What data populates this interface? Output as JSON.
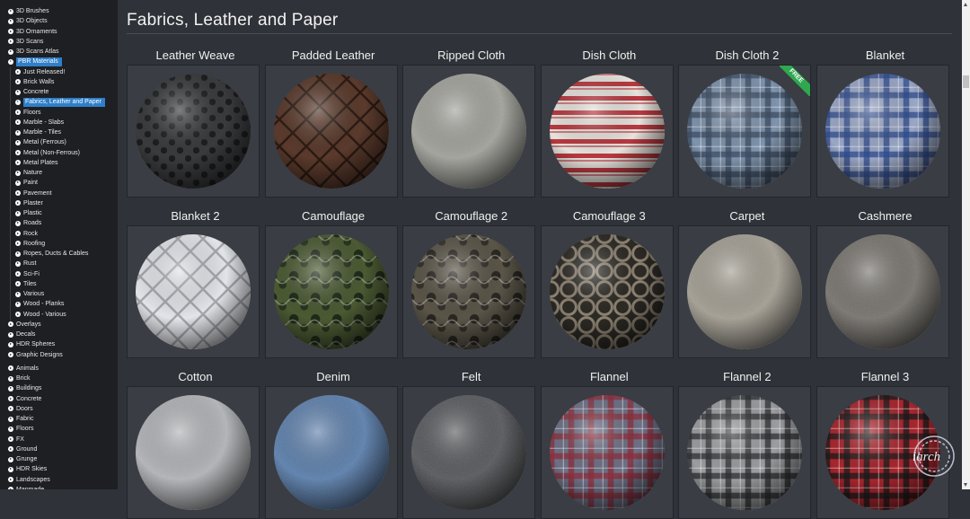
{
  "sidebar": {
    "items": [
      {
        "label": "3D Brushes",
        "level": 0
      },
      {
        "label": "3D Objects",
        "level": 0
      },
      {
        "label": "3D Ornaments",
        "level": 0
      },
      {
        "label": "3D Scans",
        "level": 0
      },
      {
        "label": "3D Scans Atlas",
        "level": 0
      },
      {
        "label": "PBR Materials",
        "level": 0,
        "active": true
      },
      {
        "label": "Just Released!",
        "level": 1
      },
      {
        "label": "Brick Walls",
        "level": 1
      },
      {
        "label": "Concrete",
        "level": 1
      },
      {
        "label": "Fabrics, Leather and Paper",
        "level": 1,
        "active": true
      },
      {
        "label": "Floors",
        "level": 1
      },
      {
        "label": "Marble - Slabs",
        "level": 1
      },
      {
        "label": "Marble - Tiles",
        "level": 1
      },
      {
        "label": "Metal (Ferrous)",
        "level": 1
      },
      {
        "label": "Metal (Non-Ferrous)",
        "level": 1
      },
      {
        "label": "Metal Plates",
        "level": 1
      },
      {
        "label": "Nature",
        "level": 1
      },
      {
        "label": "Paint",
        "level": 1
      },
      {
        "label": "Pavement",
        "level": 1
      },
      {
        "label": "Plaster",
        "level": 1
      },
      {
        "label": "Plastic",
        "level": 1
      },
      {
        "label": "Roads",
        "level": 1
      },
      {
        "label": "Rock",
        "level": 1
      },
      {
        "label": "Roofing",
        "level": 1
      },
      {
        "label": "Ropes, Ducts & Cables",
        "level": 1
      },
      {
        "label": "Rust",
        "level": 1
      },
      {
        "label": "Sci-Fi",
        "level": 1
      },
      {
        "label": "Tiles",
        "level": 1
      },
      {
        "label": "Various",
        "level": 1
      },
      {
        "label": "Wood - Planks",
        "level": 1
      },
      {
        "label": "Wood - Various",
        "level": 1
      },
      {
        "label": "Overlays",
        "level": 0
      },
      {
        "label": "Decals",
        "level": 0
      },
      {
        "label": "HDR Spheres",
        "level": 0
      },
      {
        "label": "Graphic Designs",
        "level": 0
      },
      {
        "label": "Animals",
        "level": 0,
        "gap": true
      },
      {
        "label": "Brick",
        "level": 0
      },
      {
        "label": "Buildings",
        "level": 0
      },
      {
        "label": "Concrete",
        "level": 0
      },
      {
        "label": "Doors",
        "level": 0
      },
      {
        "label": "Fabric",
        "level": 0
      },
      {
        "label": "Floors",
        "level": 0
      },
      {
        "label": "FX",
        "level": 0
      },
      {
        "label": "Ground",
        "level": 0
      },
      {
        "label": "Grunge",
        "level": 0
      },
      {
        "label": "HDR Skies",
        "level": 0
      },
      {
        "label": "Landscapes",
        "level": 0
      },
      {
        "label": "Manmade",
        "level": 0
      }
    ]
  },
  "main": {
    "title": "Fabrics, Leather and Paper",
    "materials": [
      {
        "name": "Leather Weave",
        "pattern": "weave",
        "base": "#3a3b3d",
        "accent": "#1c1d1f"
      },
      {
        "name": "Padded Leather",
        "pattern": "diamond",
        "base": "#5a3a2c",
        "accent": "#2c1a12"
      },
      {
        "name": "Ripped Cloth",
        "pattern": "noise",
        "base": "#a3a39c",
        "accent": "#6e6e68"
      },
      {
        "name": "Dish Cloth",
        "pattern": "hstripes",
        "base": "#e6e2dc",
        "accent": "#b8383f"
      },
      {
        "name": "Dish Cloth 2",
        "pattern": "plaid",
        "base": "#7f94ad",
        "accent": "#3c4c63",
        "badge": "FREE"
      },
      {
        "name": "Blanket",
        "pattern": "plaid",
        "base": "#9aa7c6",
        "accent": "#2e4a8a"
      },
      {
        "name": "Blanket 2",
        "pattern": "quilt",
        "base": "#e2e4e8",
        "accent": "#a5a8ae"
      },
      {
        "name": "Camouflage",
        "pattern": "camo",
        "base": "#4b5a33",
        "accent": "#1f2a17"
      },
      {
        "name": "Camouflage 2",
        "pattern": "camo",
        "base": "#5a5548",
        "accent": "#2a2620"
      },
      {
        "name": "Camouflage 3",
        "pattern": "lattice",
        "base": "#8c8272",
        "accent": "#2d2a25"
      },
      {
        "name": "Carpet",
        "pattern": "noise",
        "base": "#a49f93",
        "accent": "#77726a"
      },
      {
        "name": "Cashmere",
        "pattern": "noise",
        "base": "#77736d",
        "accent": "#4e4b47"
      },
      {
        "name": "Cotton",
        "pattern": "noise",
        "base": "#b3b5b9",
        "accent": "#8a8c90"
      },
      {
        "name": "Denim",
        "pattern": "noise",
        "base": "#5a7fae",
        "accent": "#35557f"
      },
      {
        "name": "Felt",
        "pattern": "noise",
        "base": "#55575b",
        "accent": "#35373a"
      },
      {
        "name": "Flannel",
        "pattern": "plaid",
        "base": "#6e7086",
        "accent": "#8c2d3a"
      },
      {
        "name": "Flannel 2",
        "pattern": "plaid",
        "base": "#9b9da0",
        "accent": "#2c2e31"
      },
      {
        "name": "Flannel 3",
        "pattern": "plaid",
        "base": "#a8262e",
        "accent": "#191919"
      }
    ]
  },
  "watermark_text": "iarch"
}
